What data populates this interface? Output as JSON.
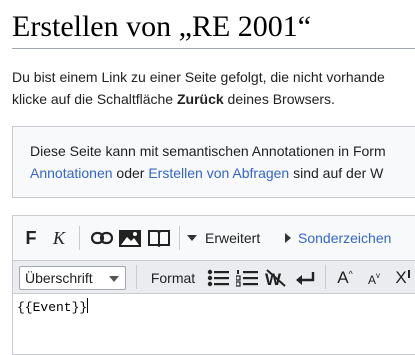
{
  "page": {
    "title": "Erstellen von „RE 2001“"
  },
  "intro": {
    "line1": "Du bist einem Link zu einer Seite gefolgt, die nicht vorhande",
    "line2_before": "klicke auf die Schaltfläche ",
    "line2_bold": "Zurück",
    "line2_after": " deines Browsers."
  },
  "notice": {
    "line1": "Diese Seite kann mit semantischen Annotationen in Form",
    "link1": "Annotationen",
    "mid": " oder ",
    "link2": "Erstellen von Abfragen",
    "tail": " sind auf der W"
  },
  "toolbar": {
    "bold_label": "F",
    "italic_label": "K",
    "advanced_label": "Erweitert",
    "special_chars_label": "Sonderzeichen",
    "heading_select_value": "Überschrift",
    "format_label": "Format",
    "big_label": "A",
    "small_label": "A",
    "superscript_label": "X"
  },
  "editor": {
    "content": "{{Event}}"
  },
  "colors": {
    "link": "#3366cc",
    "toolbar_bg": "#f8f9fa",
    "toolbar2_bg": "#eaecf0",
    "border": "#c8ccd1"
  }
}
